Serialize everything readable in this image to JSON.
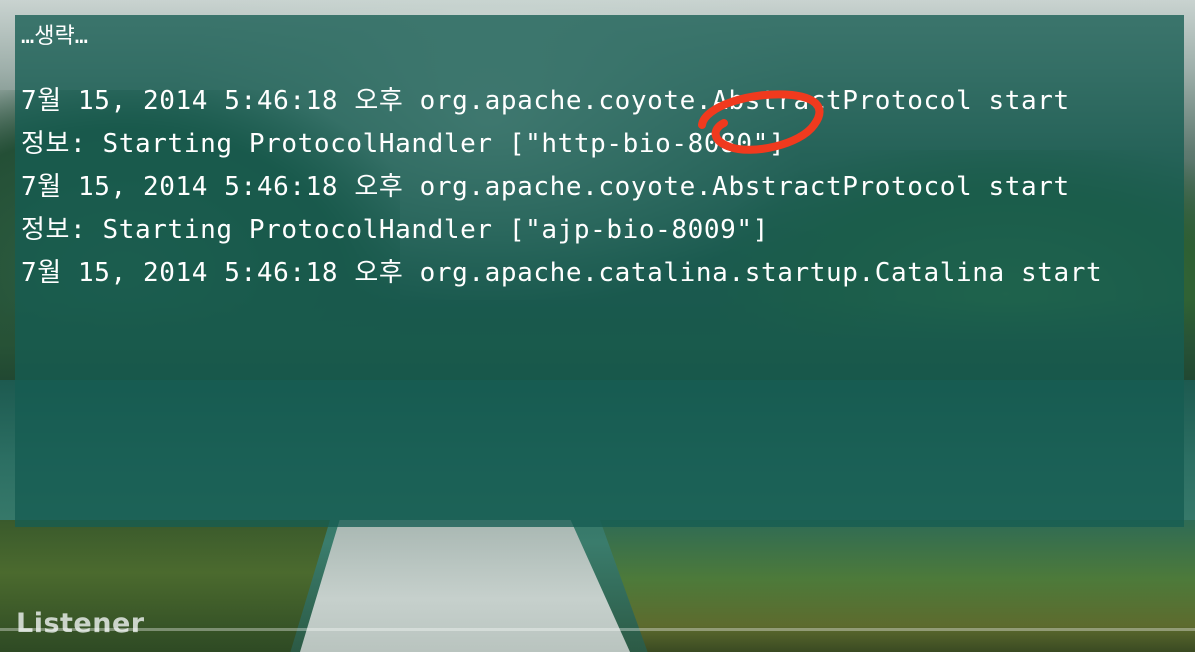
{
  "log": {
    "lines": [
      "…생략…",
      "7월 15, 2014 5:46:18 오후 org.apache.coyote.AbstractProtocol start",
      "정보: Starting ProtocolHandler [\"http-bio-8080\"]",
      "7월 15, 2014 5:46:18 오후 org.apache.coyote.AbstractProtocol start",
      "정보: Starting ProtocolHandler [\"ajp-bio-8009\"]",
      "7월 15, 2014 5:46:18 오후 org.apache.catalina.startup.Catalina start"
    ]
  },
  "annotation": {
    "color": "#f03a1e",
    "icon": "hand-drawn-circle-icon"
  },
  "overlay": {
    "background": "#165c52"
  },
  "watermark": {
    "text": "Listener"
  }
}
